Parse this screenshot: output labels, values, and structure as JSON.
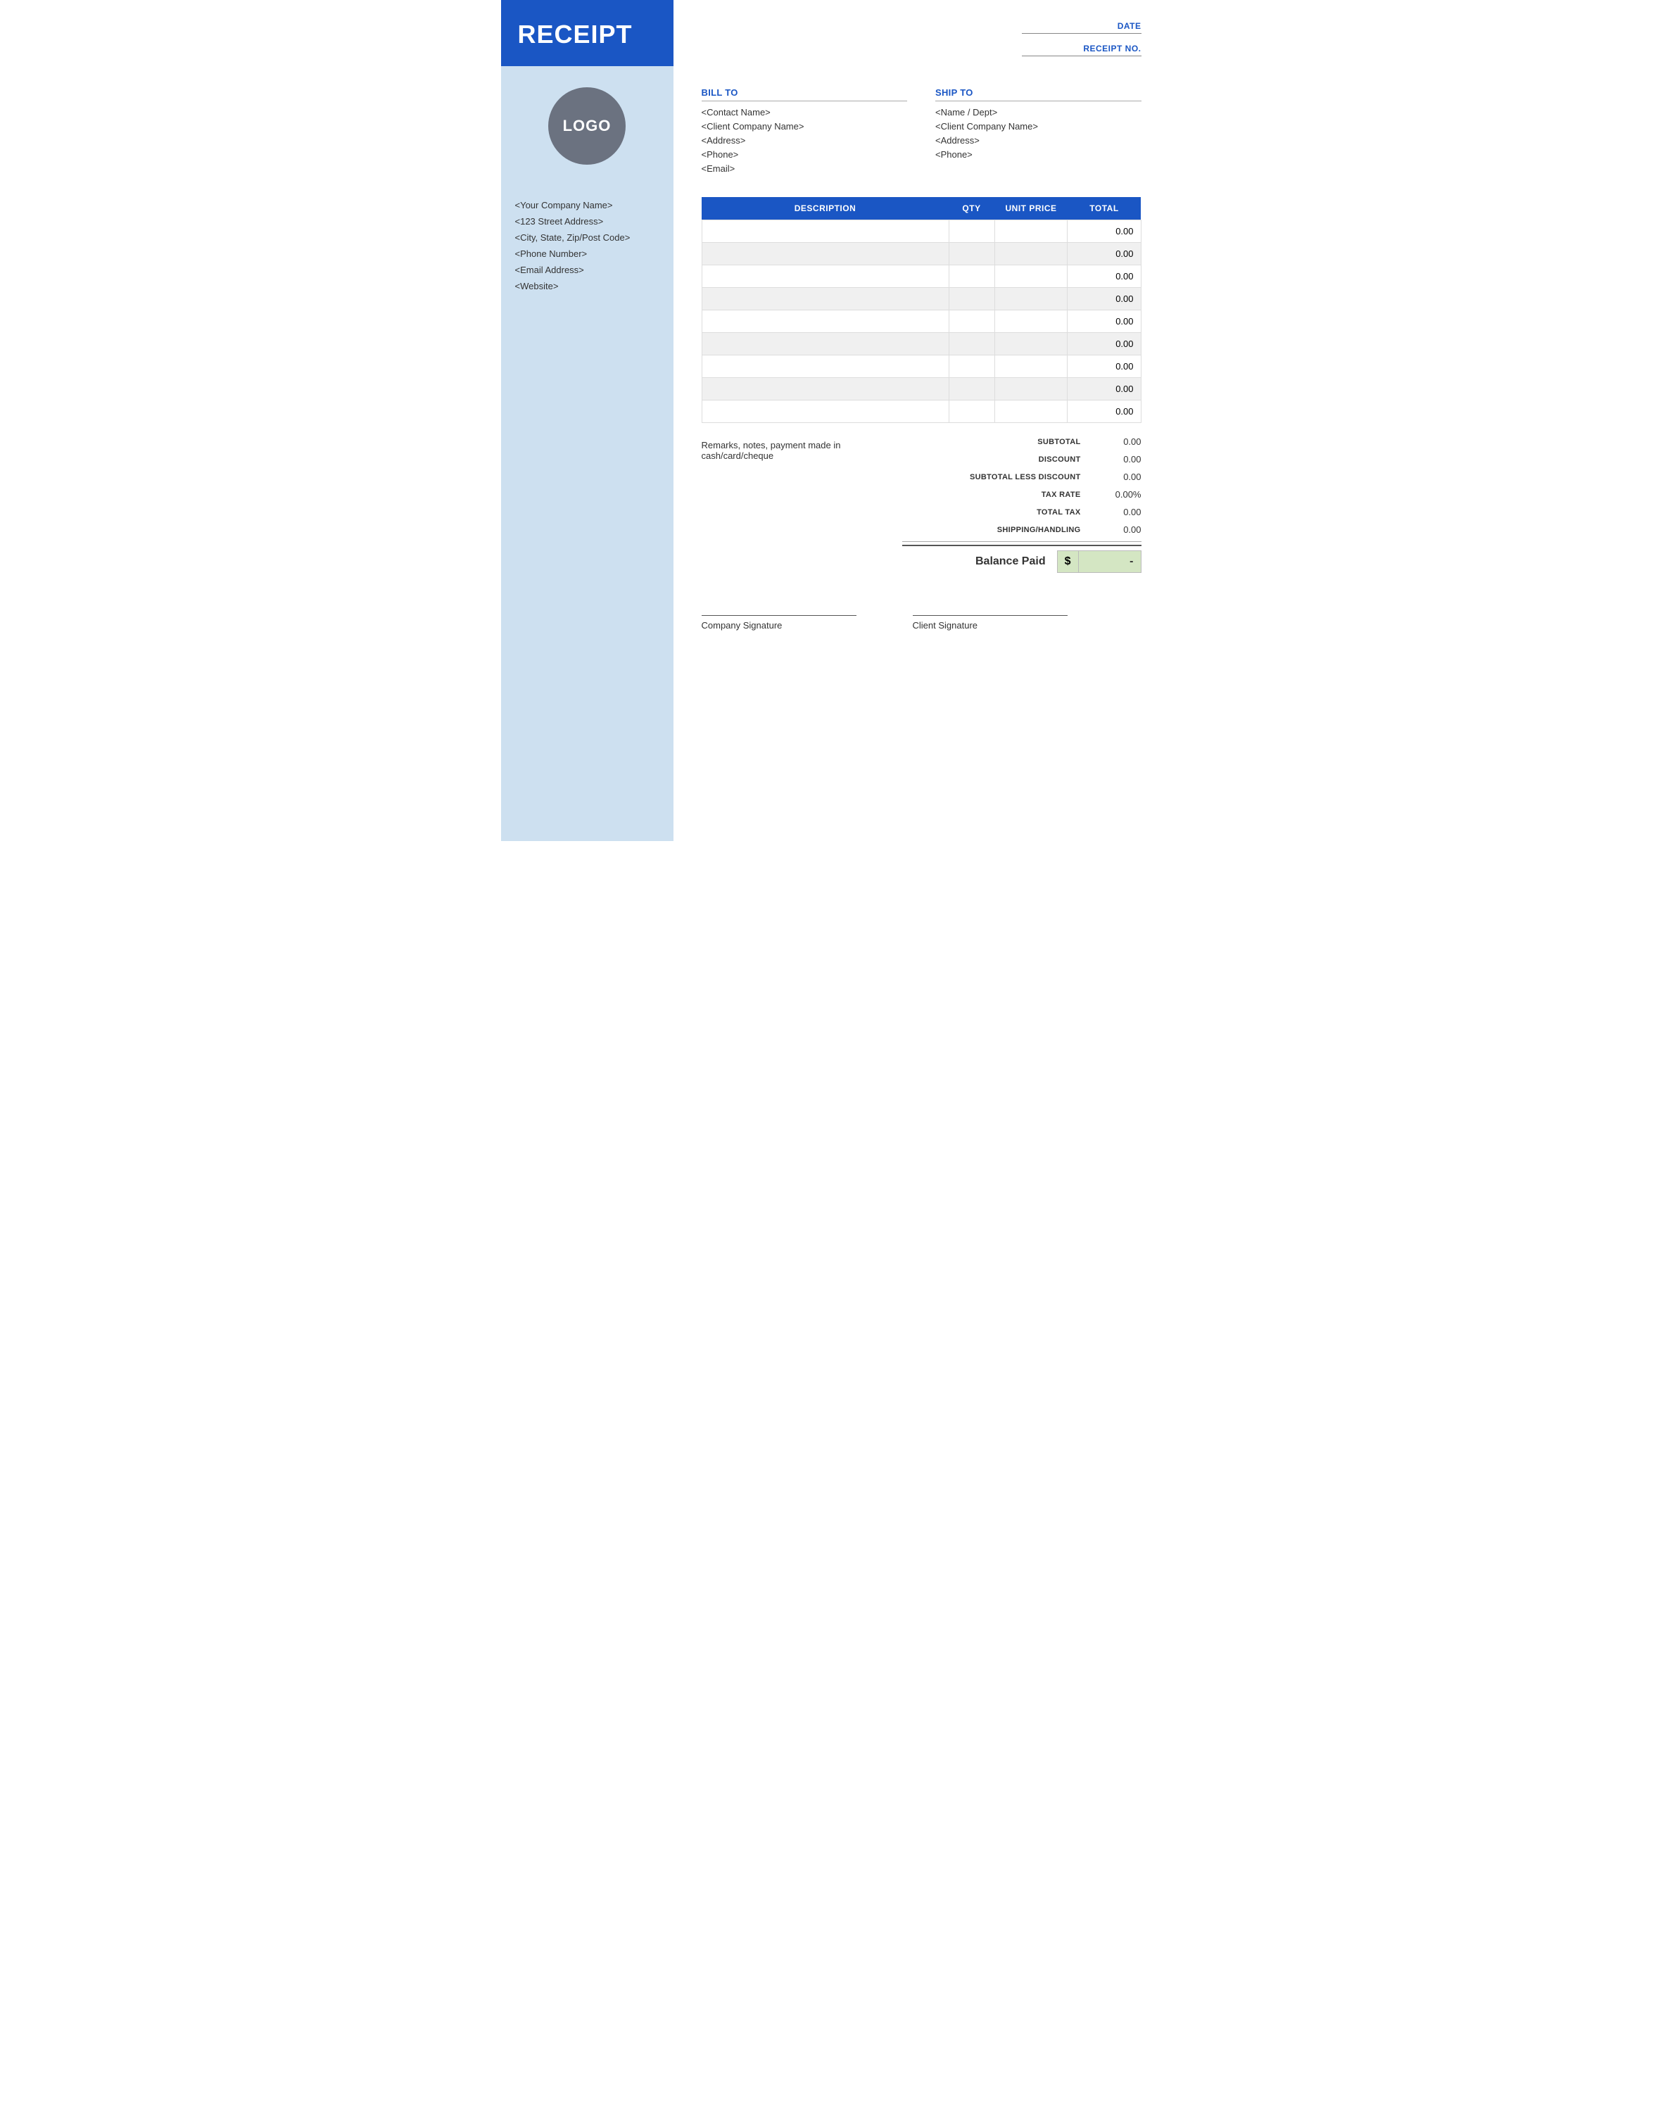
{
  "sidebar": {
    "header_title": "RECEIPT",
    "logo_text": "LOGO",
    "info": {
      "company_name": "<Your Company Name>",
      "address": "<123 Street Address>",
      "city_state": "<City, State, Zip/Post Code>",
      "phone": "<Phone Number>",
      "email": "<Email Address>",
      "website": "<Website>"
    }
  },
  "header": {
    "date_label": "DATE",
    "receipt_no_label": "RECEIPT NO."
  },
  "bill_to": {
    "label": "BILL TO",
    "contact": "<Contact Name>",
    "company": "<Client Company Name>",
    "address": "<Address>",
    "phone": "<Phone>",
    "email": "<Email>"
  },
  "ship_to": {
    "label": "SHIP TO",
    "name_dept": "<Name / Dept>",
    "company": "<Client Company Name>",
    "address": "<Address>",
    "phone": "<Phone>"
  },
  "table": {
    "columns": [
      "DESCRIPTION",
      "QTY",
      "UNIT PRICE",
      "TOTAL"
    ],
    "rows": [
      {
        "description": "",
        "qty": "",
        "unit_price": "",
        "total": "0.00"
      },
      {
        "description": "",
        "qty": "",
        "unit_price": "",
        "total": "0.00"
      },
      {
        "description": "",
        "qty": "",
        "unit_price": "",
        "total": "0.00"
      },
      {
        "description": "",
        "qty": "",
        "unit_price": "",
        "total": "0.00"
      },
      {
        "description": "",
        "qty": "",
        "unit_price": "",
        "total": "0.00"
      },
      {
        "description": "",
        "qty": "",
        "unit_price": "",
        "total": "0.00"
      },
      {
        "description": "",
        "qty": "",
        "unit_price": "",
        "total": "0.00"
      },
      {
        "description": "",
        "qty": "",
        "unit_price": "",
        "total": "0.00"
      },
      {
        "description": "",
        "qty": "",
        "unit_price": "",
        "total": "0.00"
      }
    ]
  },
  "remarks": "Remarks, notes, payment made in cash/card/cheque",
  "totals": {
    "subtotal_label": "SUBTOTAL",
    "subtotal_value": "0.00",
    "discount_label": "DISCOUNT",
    "discount_value": "0.00",
    "subtotal_less_label": "SUBTOTAL LESS DISCOUNT",
    "subtotal_less_value": "0.00",
    "tax_rate_label": "TAX RATE",
    "tax_rate_value": "0.00%",
    "total_tax_label": "TOTAL TAX",
    "total_tax_value": "0.00",
    "shipping_label": "SHIPPING/HANDLING",
    "shipping_value": "0.00",
    "balance_label": "Balance Paid",
    "balance_currency_symbol": "$",
    "balance_value": "-"
  },
  "signatures": {
    "company_label": "Company Signature",
    "client_label": "Client Signature"
  },
  "colors": {
    "blue": "#1a56c4",
    "sidebar_bg": "#cde0f0",
    "logo_bg": "#6b7280",
    "balance_bg": "#d4e6c3"
  }
}
